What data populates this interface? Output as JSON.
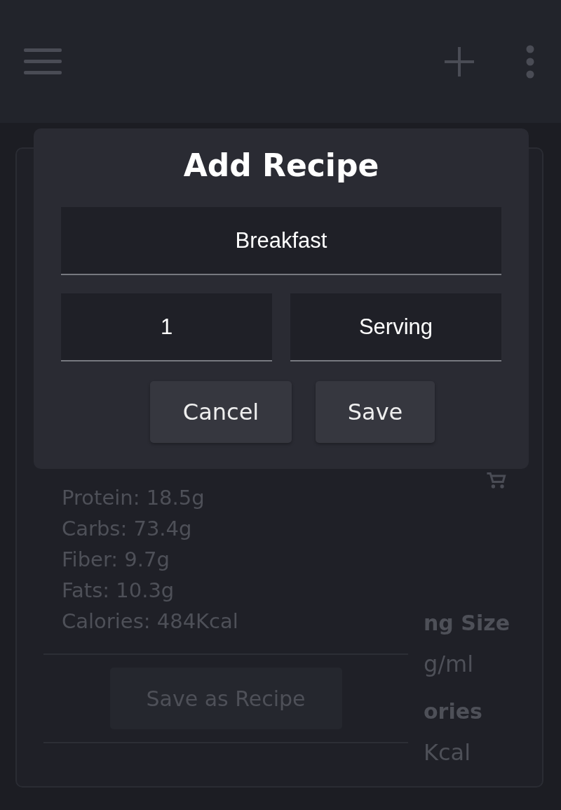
{
  "dialog": {
    "title": "Add Recipe",
    "name_field": {
      "value": "Breakfast"
    },
    "amount_field": {
      "value": "1"
    },
    "unit_field": {
      "value": "Serving"
    },
    "buttons": [
      "Cancel",
      "Save"
    ]
  },
  "nutrition": [
    "Protein: 18.5g",
    "Carbs: 73.4g",
    "Fiber: 9.7g",
    "Fats: 10.3g",
    "Calories: 484Kcal"
  ],
  "save_recipe_button": "Save as Recipe",
  "side_panel": {
    "serving_size_heading": "ng Size",
    "serving_size_value": "g/ml",
    "calories_heading": "ories",
    "calories_value": "Kcal"
  }
}
